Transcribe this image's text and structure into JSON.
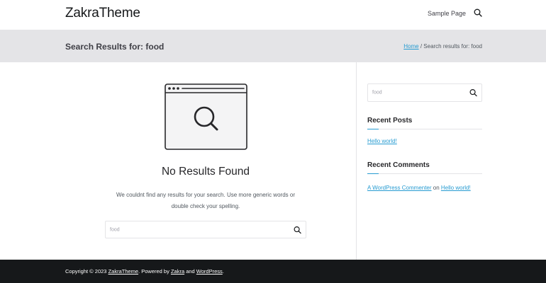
{
  "header": {
    "site_title": "ZakraTheme",
    "nav": [
      "Sample Page"
    ]
  },
  "page_header": {
    "title": "Search Results for: food",
    "breadcrumb_home": "Home",
    "breadcrumb_sep": " / ",
    "breadcrumb_current": "Search results for: food"
  },
  "content": {
    "heading": "No Results Found",
    "message": "We couldnt find any results for your search. Use more generic words or double check your spelling.",
    "search_value": "food"
  },
  "sidebar": {
    "search_value": "food",
    "recent_posts_title": "Recent Posts",
    "recent_posts": [
      "Hello world!"
    ],
    "recent_comments_title": "Recent Comments",
    "comment_author": "A WordPress Commenter",
    "comment_on": " on ",
    "comment_post": "Hello world!"
  },
  "footer": {
    "prefix": "Copyright © 2023 ",
    "site_link": "ZakraTheme",
    "powered": ". Powered by ",
    "theme_link": "Zakra",
    "and": " and ",
    "wp_link": "WordPress",
    "suffix": "."
  },
  "colors": {
    "accent": "#269bd1",
    "page_header_bg": "#e4e4e7",
    "footer_bg": "#16181a"
  }
}
